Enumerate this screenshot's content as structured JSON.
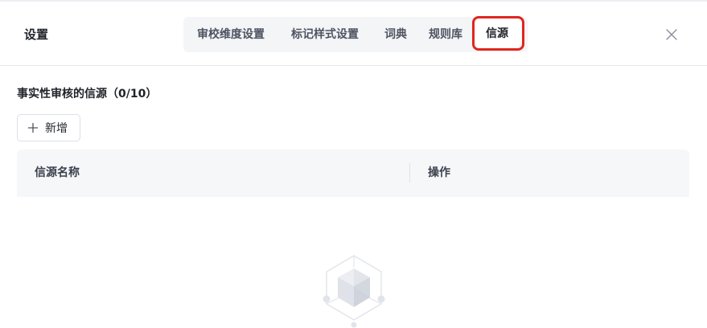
{
  "header": {
    "title": "设置"
  },
  "tabs": [
    {
      "label": "审校维度设置",
      "active": false
    },
    {
      "label": "标记样式设置",
      "active": false
    },
    {
      "label": "词典",
      "active": false
    },
    {
      "label": "规则库",
      "active": false
    },
    {
      "label": "信源",
      "active": true
    }
  ],
  "section": {
    "title": "事实性审核的信源（0/10）"
  },
  "toolbar": {
    "add_label": "新增"
  },
  "table": {
    "columns": [
      "信源名称",
      "操作"
    ],
    "rows": []
  },
  "icons": {
    "close": "close-icon",
    "add": "plus-icon",
    "empty": "empty-cube-icon"
  },
  "colors": {
    "highlight": "#e0261f",
    "header_bg": "#f6f7f9"
  }
}
